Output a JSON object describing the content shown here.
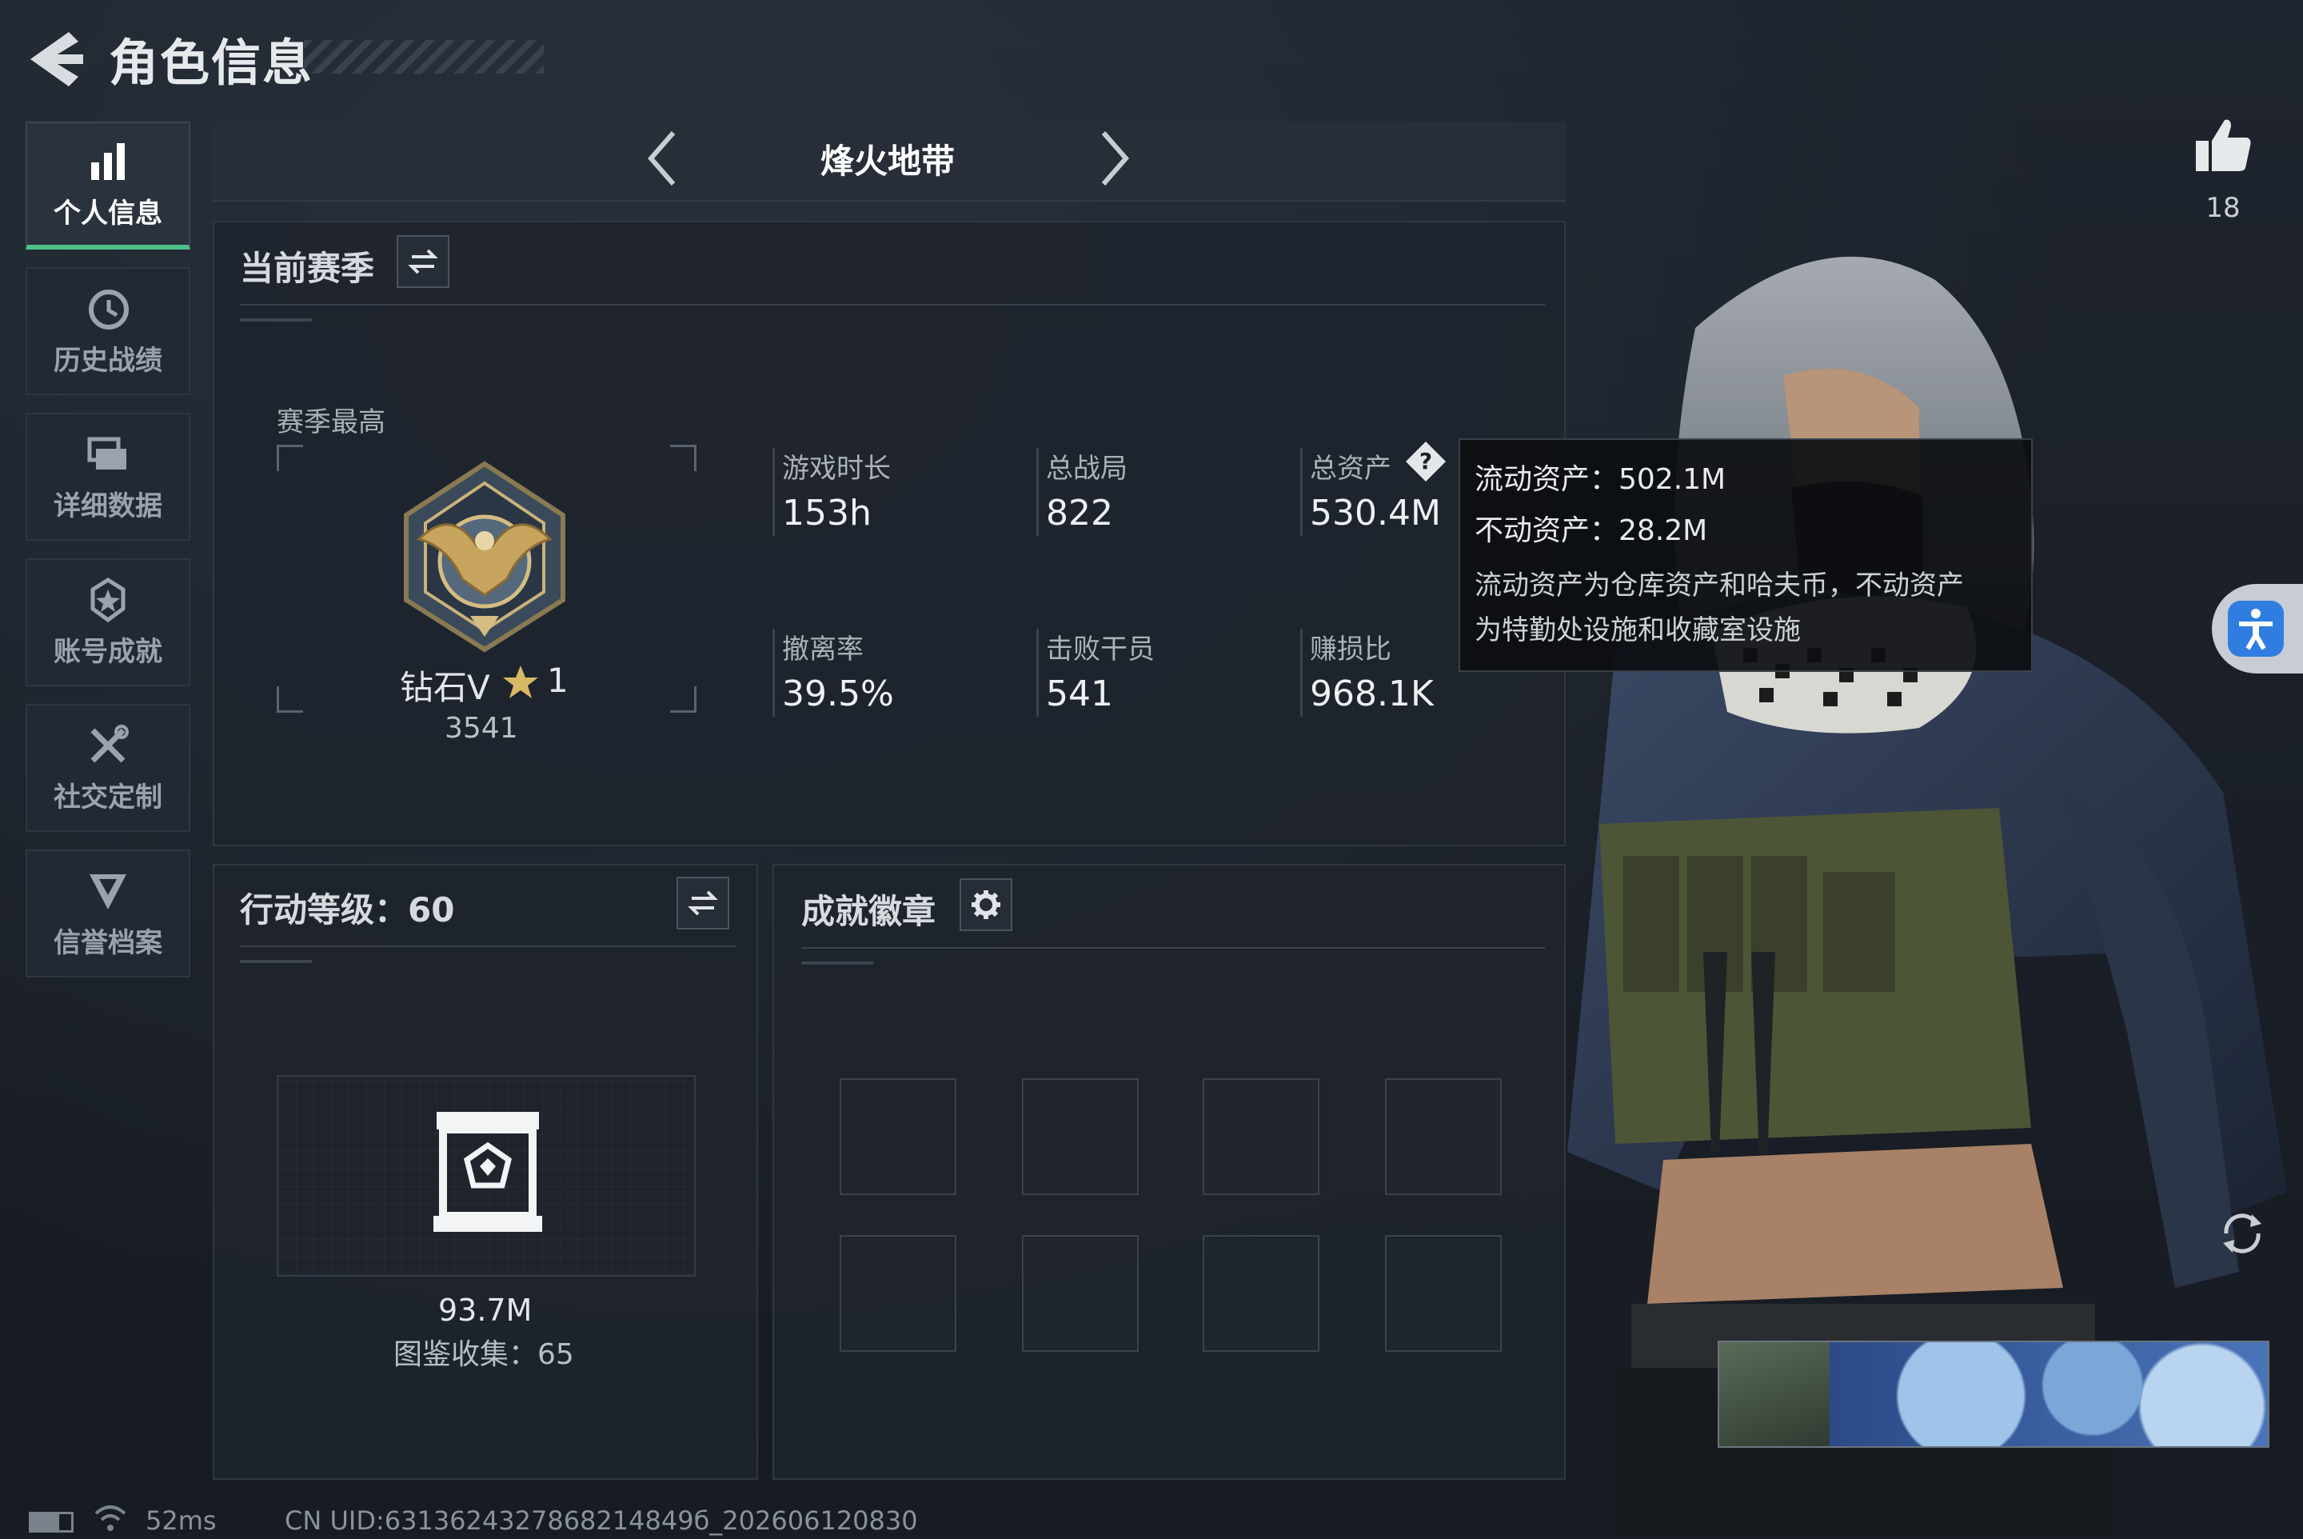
{
  "header": {
    "title": "角色信息"
  },
  "sidebar": {
    "items": [
      {
        "label": "个人信息",
        "icon": "bar-chart-icon",
        "active": true
      },
      {
        "label": "历史战绩",
        "icon": "history-clock-icon",
        "active": false
      },
      {
        "label": "详细数据",
        "icon": "stacked-cards-icon",
        "active": false
      },
      {
        "label": "账号成就",
        "icon": "achievement-star-icon",
        "active": false
      },
      {
        "label": "社交定制",
        "icon": "tools-icon",
        "active": false
      },
      {
        "label": "信誉档案",
        "icon": "shield-badge-icon",
        "active": false
      }
    ]
  },
  "mode_selector": {
    "title": "烽火地带"
  },
  "season": {
    "title": "当前赛季",
    "best_label": "赛季最高",
    "rank_name": "钻石V",
    "rank_stars": "1",
    "rank_score": "3541",
    "stats": [
      {
        "label": "游戏时长",
        "value": "153h"
      },
      {
        "label": "总战局",
        "value": "822"
      },
      {
        "label": "总资产",
        "value": "530.4M"
      },
      {
        "label": "撤离率",
        "value": "39.5%"
      },
      {
        "label": "击败干员",
        "value": "541"
      },
      {
        "label": "赚损比",
        "value": "968.1K"
      }
    ]
  },
  "tooltip": {
    "liquid": "流动资产：502.1M",
    "fixed": "不动资产：28.2M",
    "desc_line1": "流动资产为仓库资产和哈夫币，不动资产",
    "desc_line2": "为特勤处设施和收藏室设施"
  },
  "action_level": {
    "title": "行动等级：60",
    "value": "93.7M",
    "collection": "图鉴收集：65"
  },
  "achievements": {
    "title": "成就徽章",
    "slots": 8
  },
  "likes": {
    "count": "18"
  },
  "status_bar": {
    "ping": "52ms",
    "uid": "CN UID:6313624327868214849б_202606120830"
  },
  "colors": {
    "accent": "#4fbf8a",
    "background": "#1a1f27",
    "accessibility": "#2f7de1"
  }
}
